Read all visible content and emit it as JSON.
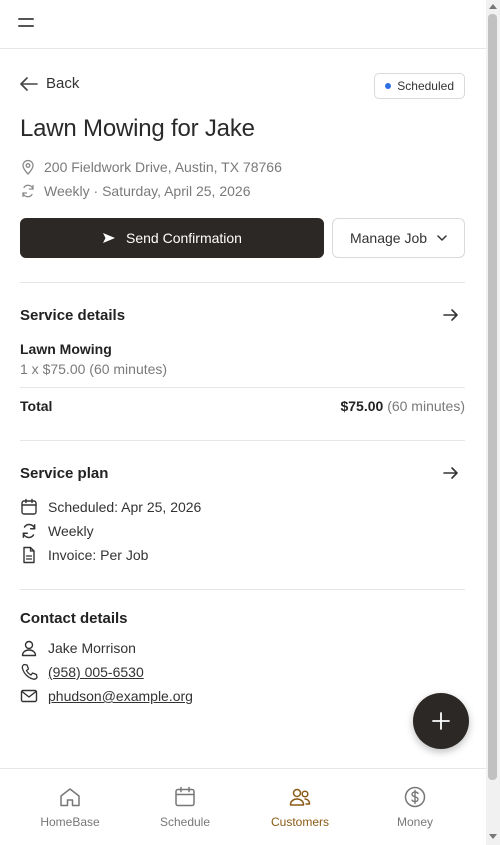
{
  "header": {
    "menu_icon": "hamburger-icon"
  },
  "nav": {
    "back_label": "Back"
  },
  "job": {
    "status": "Scheduled",
    "status_color": "#2f6fe4",
    "title": "Lawn Mowing for Jake",
    "address": "200 Fieldwork Drive, Austin, TX 78766",
    "schedule": "Weekly · Saturday, April 25, 2026"
  },
  "actions": {
    "send_confirmation": "Send Confirmation",
    "manage_job": "Manage Job"
  },
  "service_details": {
    "title": "Service details",
    "item_name": "Lawn Mowing",
    "item_detail": "1 x $75.00 (60 minutes)",
    "total_label": "Total",
    "total_amount": "$75.00",
    "total_duration": "(60 minutes)"
  },
  "service_plan": {
    "title": "Service plan",
    "scheduled": "Scheduled: Apr 25, 2026",
    "frequency": "Weekly",
    "invoice": "Invoice: Per Job"
  },
  "contact": {
    "title": "Contact details",
    "name": "Jake Morrison",
    "phone": "(958) 005-6530",
    "email": "phudson@example.org"
  },
  "bottom_nav": {
    "items": [
      {
        "label": "HomeBase",
        "icon": "home-icon"
      },
      {
        "label": "Schedule",
        "icon": "calendar-icon"
      },
      {
        "label": "Customers",
        "icon": "customers-icon",
        "active": true
      },
      {
        "label": "Money",
        "icon": "dollar-icon"
      }
    ]
  },
  "colors": {
    "primary_dark": "#2b2825",
    "active_nav": "#8a5a16"
  }
}
